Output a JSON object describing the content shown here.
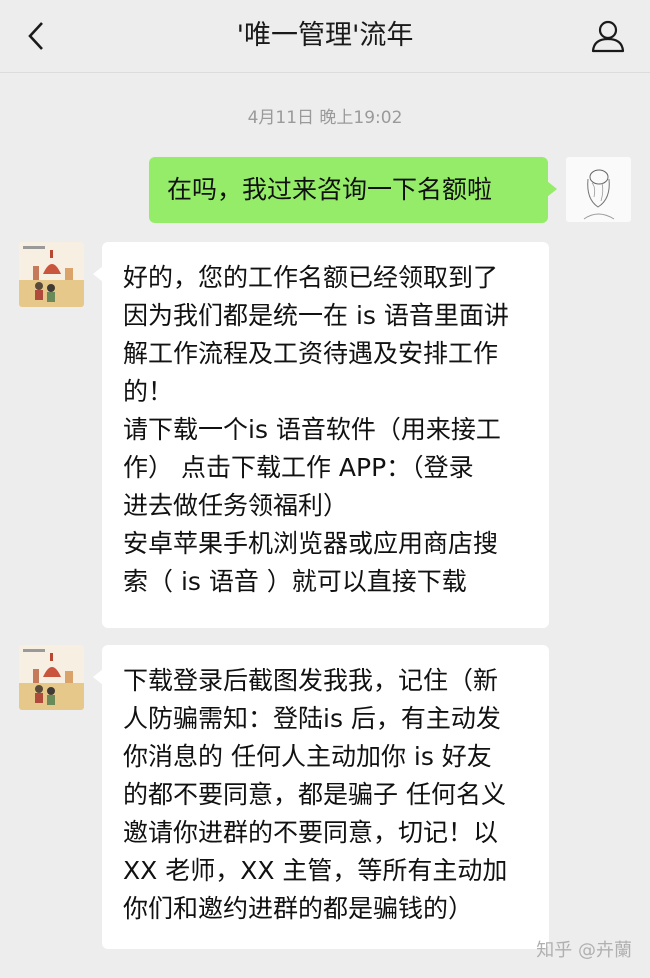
{
  "header": {
    "title": "'唯一管理'流年",
    "back_icon": "chevron-left-icon",
    "profile_icon": "person-icon"
  },
  "timestamp": "4月11日 晚上19:02",
  "messages": [
    {
      "sender": "me",
      "text": "在吗，我过来咨询一下名额啦"
    },
    {
      "sender": "other",
      "text": "好的，您的工作名额已经领取到了\n因为我们都是统一在 is 语音里面讲\n解工作流程及工资待遇及安排工作\n的！\n请下载一个is 语音软件（用来接工\n作） 点击下载工作 APP：（登录\n进去做任务领福利）\n安卓苹果手机浏览器或应用商店搜\n索（ is 语音 ）就可以直接下载"
    },
    {
      "sender": "other",
      "text": "下载登录后截图发我我，记住（新\n人防骗需知：登陆is 后，有主动发\n你消息的 任何人主动加你 is 好友\n的都不要同意，都是骗子 任何名义\n邀请你进群的不要同意，切记！以\nXX 老师，XX 主管，等所有主动加\n你们和邀约进群的都是骗钱的）"
    }
  ],
  "watermark": "知乎 @卉蘭",
  "colors": {
    "background": "#ededed",
    "bubble_me": "#95ec69",
    "bubble_other": "#ffffff"
  }
}
